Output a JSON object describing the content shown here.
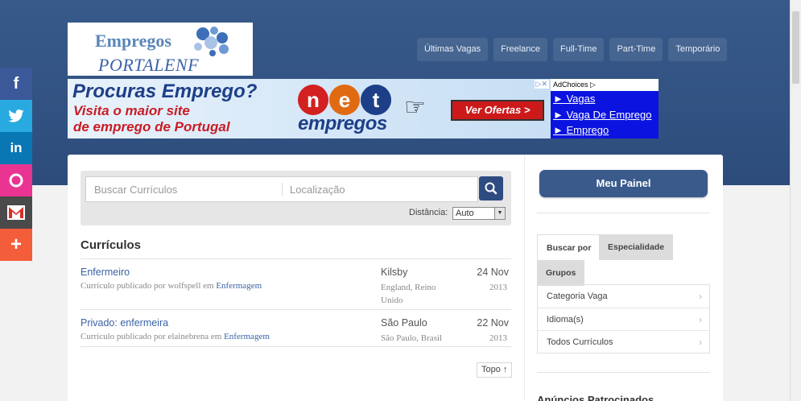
{
  "logo": {
    "line1": "Empregos",
    "line2": "PORTALENF"
  },
  "nav": [
    {
      "label": "Últimas Vagas"
    },
    {
      "label": "Freelance"
    },
    {
      "label": "Full-Time"
    },
    {
      "label": "Part-Time"
    },
    {
      "label": "Temporário"
    }
  ],
  "banner": {
    "headline": "Procuras Emprego?",
    "subline1": "Visita o maior site",
    "subline2": "de emprego de Portugal",
    "brand_top": "net",
    "brand_bottom": "empregos",
    "cta": "Ver Ofertas >"
  },
  "adbox": {
    "adchoices": "AdChoices",
    "links": [
      "► Vagas",
      "► Vaga De Emprego",
      "► Emprego"
    ]
  },
  "social": [
    {
      "icon": "facebook-icon",
      "glyph": "f",
      "color": "#3b5998"
    },
    {
      "icon": "twitter-icon",
      "glyph": "🐦",
      "color": "#28a9e0"
    },
    {
      "icon": "linkedin-icon",
      "glyph": "in",
      "color": "#0a77b5"
    },
    {
      "icon": "orkut-icon",
      "glyph": "O",
      "color": "#e93492"
    },
    {
      "icon": "gmail-icon",
      "glyph": "M",
      "color": "#4a4a4a"
    },
    {
      "icon": "share-more-icon",
      "glyph": "+",
      "color": "#f35d39"
    }
  ],
  "search": {
    "keyword_placeholder": "Buscar Currículos",
    "location_placeholder": "Localização",
    "distance_label": "Distância:",
    "distance_value": "Auto"
  },
  "resumes": {
    "title": "Currículos",
    "items": [
      {
        "title": "Enfermeiro",
        "prefix": "Currículo publicado por wolfspell em ",
        "category": "Enfermagem",
        "city": "Kilsby",
        "region": "England, Reino Unido",
        "date": "24 Nov",
        "year": "2013"
      },
      {
        "title": "Privado: enfermeira",
        "prefix": "Currículo publicado por elainebrena em ",
        "category": "Enfermagem",
        "city": "São Paulo",
        "region": "São Paulo, Brasil",
        "date": "22 Nov",
        "year": "2013"
      }
    ],
    "top_label": "Topo ↑"
  },
  "sidebar": {
    "panel_button": "Meu Painel",
    "tabs": [
      "Buscar por",
      "Especialidade",
      "Grupos"
    ],
    "menu": [
      "Categoria Vaga",
      "Idioma(s)",
      "Todos Currículos"
    ],
    "sponsored_title": "Anúncios Patrocinados"
  },
  "colors": {
    "header": "#2d4c7c",
    "accent": "#3a5a8c",
    "link": "#3a63a8"
  }
}
